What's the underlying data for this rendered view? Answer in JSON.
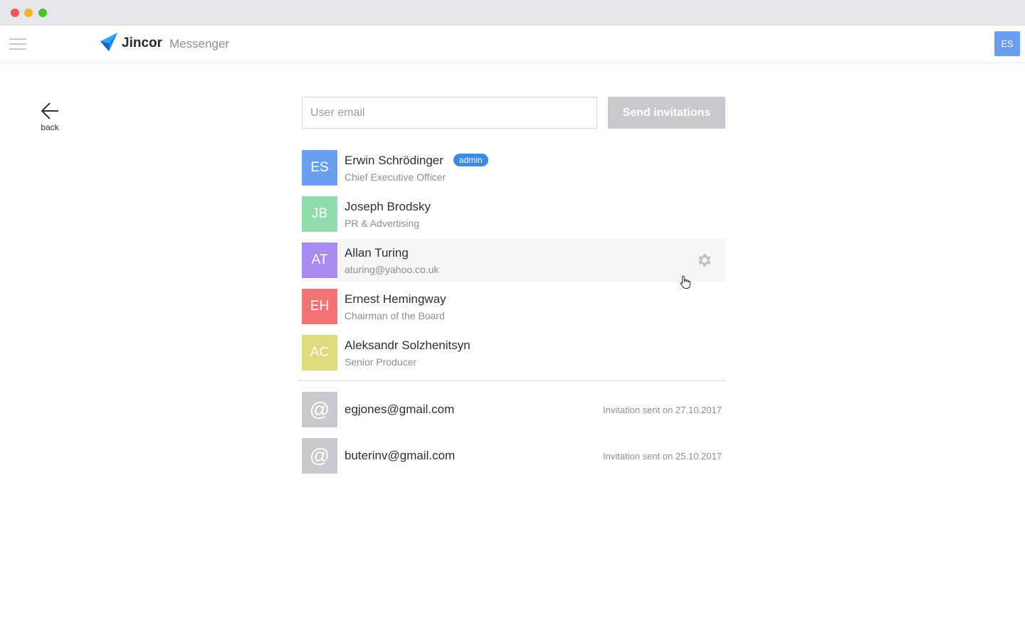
{
  "app": {
    "brand": "Jincor",
    "product": "Messenger",
    "user_initials": "ES"
  },
  "nav": {
    "back_label": "back"
  },
  "invite": {
    "placeholder": "User email",
    "value": "",
    "send_label": "Send invitations"
  },
  "members": [
    {
      "initials": "ES",
      "name": "Erwin Schrödinger",
      "subtitle": "Chief Executive Officer",
      "badge": "admin",
      "color": "#6a9ff0"
    },
    {
      "initials": "JB",
      "name": "Joseph Brodsky",
      "subtitle": "PR & Advertising",
      "color": "#8fdcac"
    },
    {
      "initials": "AT",
      "name": "Allan Turing",
      "subtitle": "aturing@yahoo.co.uk",
      "color": "#a78af2",
      "hovered": true
    },
    {
      "initials": "EH",
      "name": "Ernest Hemingway",
      "subtitle": "Chairman of the Board",
      "color": "#f47474"
    },
    {
      "initials": "AC",
      "name": "Aleksandr Solzhenitsyn",
      "subtitle": "Senior Producer",
      "color": "#dedb7c"
    }
  ],
  "pending_invites": [
    {
      "symbol": "@",
      "email": "egjones@gmail.com",
      "status": "Invitation sent on 27.10.2017"
    },
    {
      "symbol": "@",
      "email": "buterinv@gmail.com",
      "status": "Invitation sent on 25.10.2017"
    }
  ],
  "icons": {
    "menu": "hamburger-icon",
    "logo": "jincor-logo-icon",
    "back": "arrow-left-icon",
    "settings": "gear-icon",
    "email": "at-sign-icon"
  },
  "colors": {
    "accent": "#3b8ae6",
    "avatar_blue": "#6a9ff0",
    "button_disabled": "#c8cacd"
  }
}
